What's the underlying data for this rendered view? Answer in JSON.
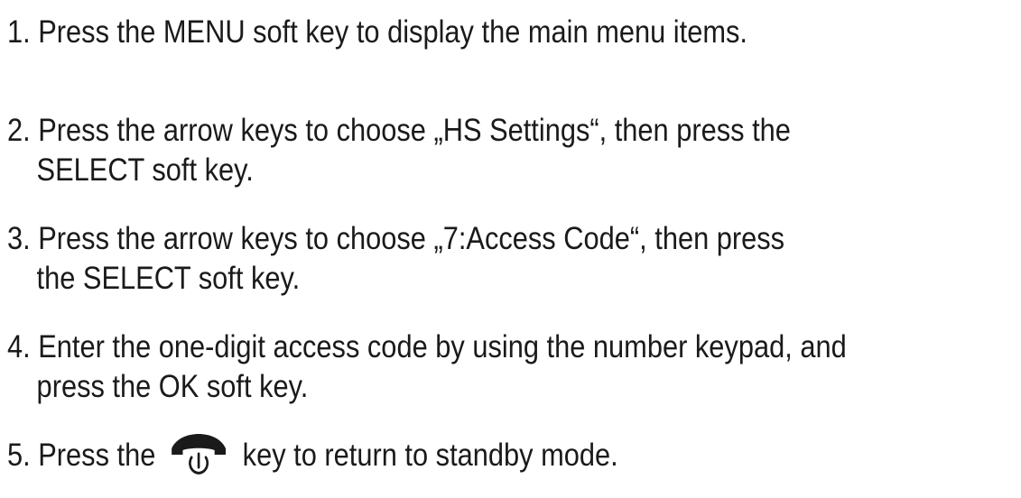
{
  "steps": [
    {
      "line1": "1. Press the MENU soft key to display the main menu items."
    },
    {
      "line1": "2. Press the arrow keys to choose „HS Settings“, then press the",
      "line2": "SELECT soft key."
    },
    {
      "line1": "3. Press the arrow keys to choose „7:Access Code“, then press",
      "line2": "the SELECT soft key."
    },
    {
      "line1": "4. Enter the one-digit access code by using the number keypad, and",
      "line2": "press the OK soft key."
    },
    {
      "before_icon": "5. Press the",
      "icon": "end-call-power-icon",
      "after_icon": "key to return to standby mode."
    }
  ]
}
